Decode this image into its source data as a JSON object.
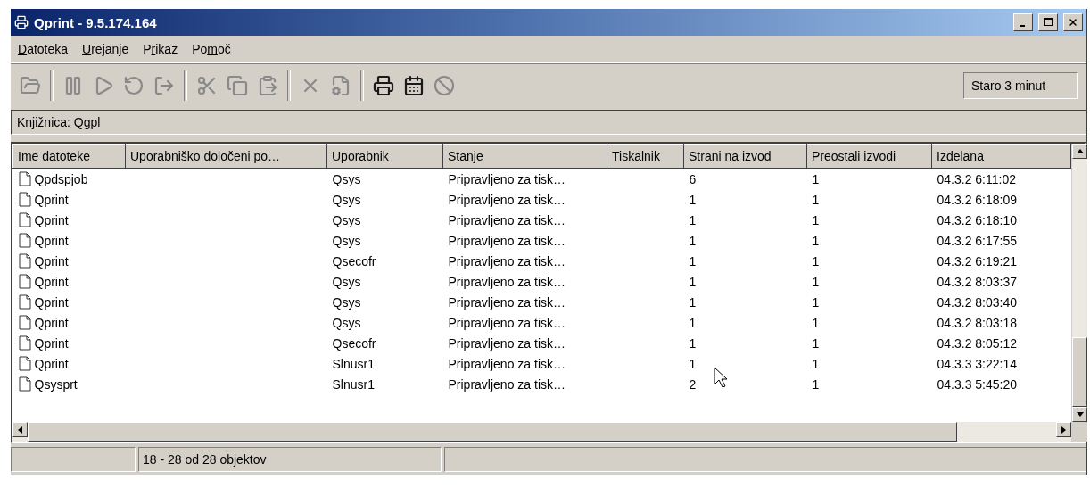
{
  "window": {
    "title": "Qprint - 9.5.174.164"
  },
  "menu": [
    {
      "key": "D",
      "after": "atoteka"
    },
    {
      "key": "U",
      "after": "rejanje"
    },
    {
      "before": "P",
      "key": "r",
      "after": "ikaz"
    },
    {
      "before": "Po",
      "key": "m",
      "after": "oč"
    }
  ],
  "toolbar": [
    {
      "kind": "open",
      "disabled": true
    },
    {
      "kind": "sep"
    },
    {
      "kind": "pause",
      "disabled": true
    },
    {
      "kind": "play",
      "disabled": true
    },
    {
      "kind": "reply",
      "disabled": true
    },
    {
      "kind": "move",
      "disabled": true
    },
    {
      "kind": "sep"
    },
    {
      "kind": "cut",
      "disabled": true
    },
    {
      "kind": "copy",
      "disabled": true
    },
    {
      "kind": "paste",
      "disabled": true
    },
    {
      "kind": "sep"
    },
    {
      "kind": "delete",
      "disabled": true
    },
    {
      "kind": "properties",
      "disabled": true
    },
    {
      "kind": "sep"
    },
    {
      "kind": "printer",
      "disabled": false
    },
    {
      "kind": "calendar",
      "disabled": false
    },
    {
      "kind": "stop",
      "disabled": true
    }
  ],
  "age": "Staro 3 minut",
  "library": "Knjižnica: Qgpl",
  "table": {
    "columns": [
      "Ime datoteke",
      "Uporabniško določeni po…",
      "Uporabnik",
      "Stanje",
      "Tiskalnik",
      "Strani na izvod",
      "Preostali izvodi",
      "Izdelana"
    ],
    "rows": [
      {
        "name": "Qpdspjob",
        "user": "Qsys",
        "status": "Pripravljeno za tisk…",
        "pages": "6",
        "copies": "1",
        "created": "04.3.2 6:11:02"
      },
      {
        "name": "Qprint",
        "user": "Qsys",
        "status": "Pripravljeno za tisk…",
        "pages": "1",
        "copies": "1",
        "created": "04.3.2 6:18:09"
      },
      {
        "name": "Qprint",
        "user": "Qsys",
        "status": "Pripravljeno za tisk…",
        "pages": "1",
        "copies": "1",
        "created": "04.3.2 6:18:10"
      },
      {
        "name": "Qprint",
        "user": "Qsys",
        "status": "Pripravljeno za tisk…",
        "pages": "1",
        "copies": "1",
        "created": "04.3.2 6:17:55"
      },
      {
        "name": "Qprint",
        "user": "Qsecofr",
        "status": "Pripravljeno za tisk…",
        "pages": "1",
        "copies": "1",
        "created": "04.3.2 6:19:21"
      },
      {
        "name": "Qprint",
        "user": "Qsys",
        "status": "Pripravljeno za tisk…",
        "pages": "1",
        "copies": "1",
        "created": "04.3.2 8:03:37"
      },
      {
        "name": "Qprint",
        "user": "Qsys",
        "status": "Pripravljeno za tisk…",
        "pages": "1",
        "copies": "1",
        "created": "04.3.2 8:03:40"
      },
      {
        "name": "Qprint",
        "user": "Qsys",
        "status": "Pripravljeno za tisk…",
        "pages": "1",
        "copies": "1",
        "created": "04.3.2 8:03:18"
      },
      {
        "name": "Qprint",
        "user": "Qsecofr",
        "status": "Pripravljeno za tisk…",
        "pages": "1",
        "copies": "1",
        "created": "04.3.2 8:05:12"
      },
      {
        "name": "Qprint",
        "user": "Slnusr1",
        "status": "Pripravljeno za tisk…",
        "pages": "1",
        "copies": "1",
        "created": "04.3.3 3:22:14"
      },
      {
        "name": "Qsysprt",
        "user": "Slnusr1",
        "status": "Pripravljeno za tisk…",
        "pages": "2",
        "copies": "1",
        "created": "04.3.3 5:45:20"
      }
    ]
  },
  "status_bar": {
    "count": "18 - 28 od 28 objektov"
  }
}
